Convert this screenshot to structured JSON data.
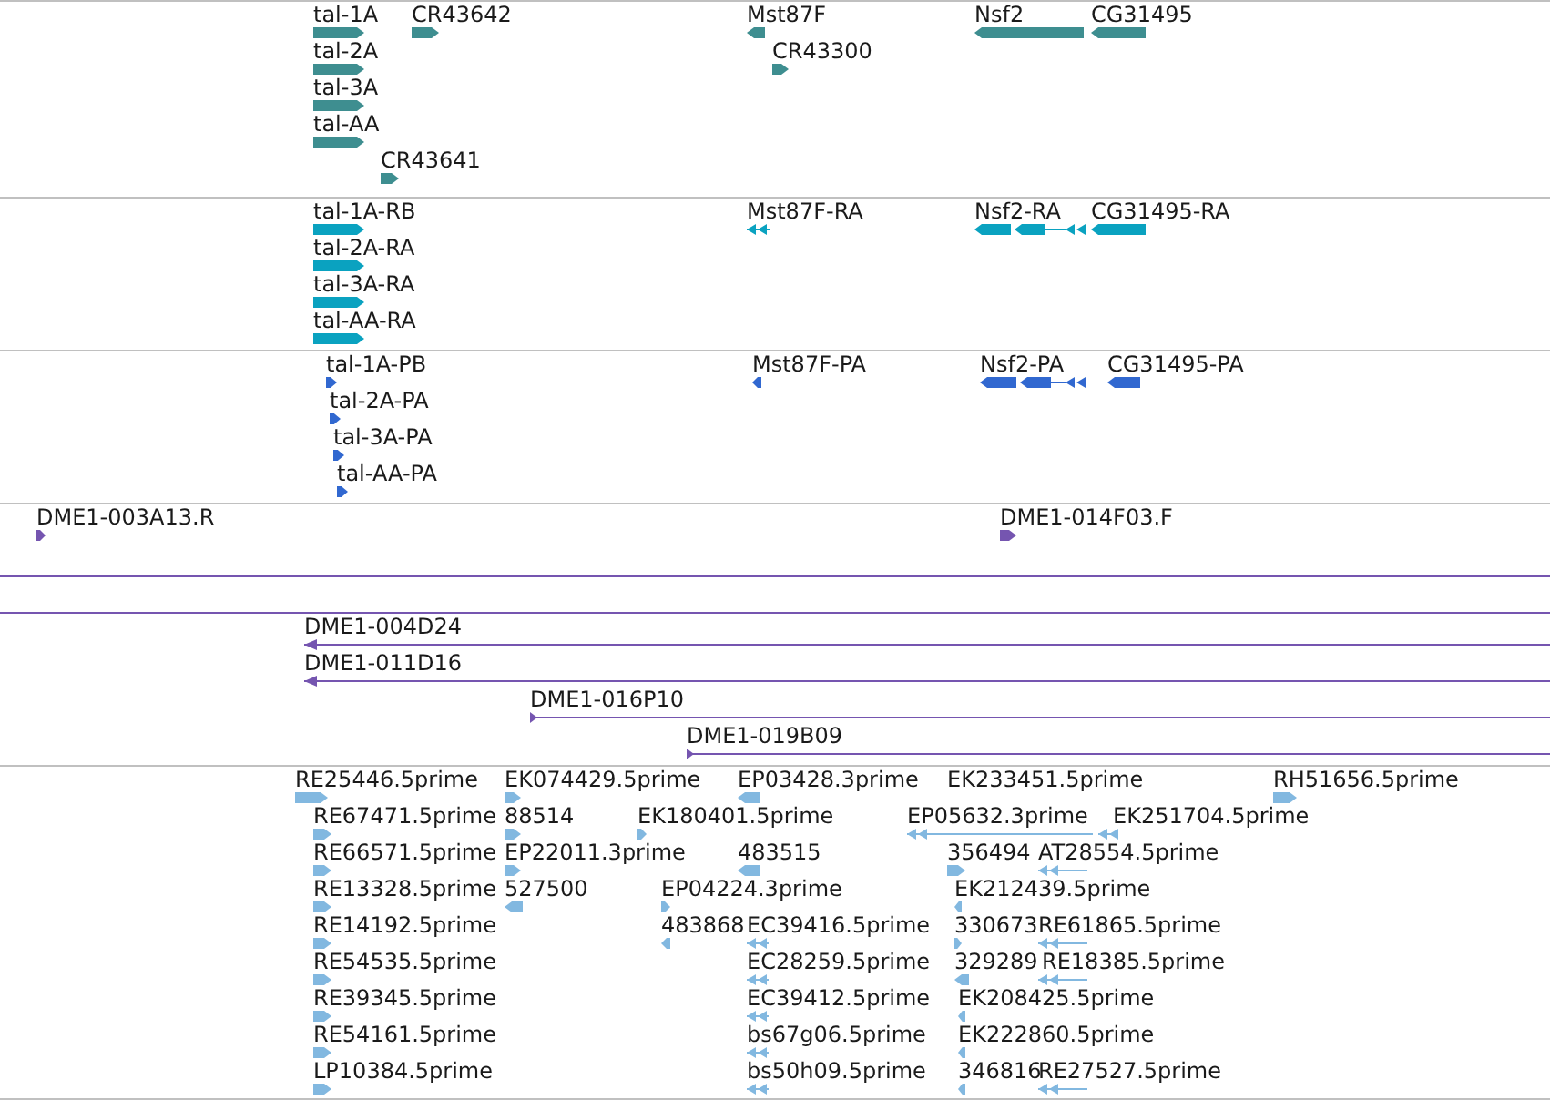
{
  "tracks": [
    {
      "color": "#3e8e90",
      "features": [
        {
          "label": "tal-1A",
          "reverse": false
        },
        {
          "label": "CR43642",
          "reverse": false
        },
        {
          "label": "Mst87F",
          "reverse": true
        },
        {
          "label": "Nsf2",
          "reverse": true
        },
        {
          "label": "CG31495",
          "reverse": true
        },
        {
          "label": "CR43300",
          "reverse": false
        },
        {
          "label": "tal-2A",
          "reverse": false
        },
        {
          "label": "tal-3A",
          "reverse": false
        },
        {
          "label": "tal-AA",
          "reverse": false
        },
        {
          "label": "CR43641",
          "reverse": false
        }
      ]
    },
    {
      "color": "#0aa2c0",
      "features": [
        {
          "label": "tal-1A-RB",
          "reverse": false
        },
        {
          "label": "Mst87F-RA",
          "reverse": true
        },
        {
          "label": "Nsf2-RA",
          "reverse": true
        },
        {
          "label": "CG31495-RA",
          "reverse": true
        },
        {
          "label": "tal-2A-RA",
          "reverse": false
        },
        {
          "label": "tal-3A-RA",
          "reverse": false
        },
        {
          "label": "tal-AA-RA",
          "reverse": false
        }
      ]
    },
    {
      "color": "#3168d0",
      "features": [
        {
          "label": "tal-1A-PB",
          "reverse": false
        },
        {
          "label": "Mst87F-PA",
          "reverse": true
        },
        {
          "label": "Nsf2-PA",
          "reverse": true
        },
        {
          "label": "CG31495-PA",
          "reverse": true
        },
        {
          "label": "tal-2A-PA",
          "reverse": false
        },
        {
          "label": "tal-3A-PA",
          "reverse": false
        },
        {
          "label": "tal-AA-PA",
          "reverse": false
        }
      ]
    },
    {
      "color": "#7555b0",
      "features": [
        {
          "label": "DME1-003A13.R",
          "reverse": false
        },
        {
          "label": "DME1-014F03.F",
          "reverse": false
        }
      ]
    },
    {
      "color": "#7555b0"
    },
    {
      "color": "#7555b0",
      "features": [
        {
          "label": "DME1-004D24",
          "reverse": true
        },
        {
          "label": "DME1-011D16",
          "reverse": true
        },
        {
          "label": "DME1-016P10",
          "reverse": false
        },
        {
          "label": "DME1-019B09",
          "reverse": false
        }
      ]
    },
    {
      "color": "#82b8e0",
      "features": [
        {
          "label": "RE25446.5prime",
          "reverse": false
        },
        {
          "label": "EK074429.5prime",
          "reverse": false
        },
        {
          "label": "EP03428.3prime",
          "reverse": true
        },
        {
          "label": "EK233451.5prime"
        },
        {
          "label": "RH51656.5prime",
          "reverse": false
        },
        {
          "label": "RE67471.5prime",
          "reverse": false
        },
        {
          "label": "88514",
          "reverse": false
        },
        {
          "label": "EK180401.5prime",
          "reverse": false
        },
        {
          "label": "EP05632.3prime",
          "reverse": true
        },
        {
          "label": "EK251704.5prime",
          "reverse": true
        },
        {
          "label": "RE66571.5prime",
          "reverse": false
        },
        {
          "label": "EP22011.3prime",
          "reverse": false
        },
        {
          "label": "483515",
          "reverse": true
        },
        {
          "label": "356494",
          "reverse": false
        },
        {
          "label": "AT28554.5prime",
          "reverse": true
        },
        {
          "label": "RE13328.5prime",
          "reverse": false
        },
        {
          "label": "527500",
          "reverse": true
        },
        {
          "label": "EP04224.3prime",
          "reverse": false
        },
        {
          "label": "EK212439.5prime",
          "reverse": true
        },
        {
          "label": "RE14192.5prime",
          "reverse": false
        },
        {
          "label": "483868",
          "reverse": true
        },
        {
          "label": "EC39416.5prime",
          "reverse": true
        },
        {
          "label": "330673",
          "reverse": false
        },
        {
          "label": "RE61865.5prime",
          "reverse": true
        },
        {
          "label": "RE54535.5prime",
          "reverse": false
        },
        {
          "label": "EC28259.5prime",
          "reverse": true
        },
        {
          "label": "329289",
          "reverse": true
        },
        {
          "label": "RE18385.5prime",
          "reverse": true
        },
        {
          "label": "RE39345.5prime",
          "reverse": false
        },
        {
          "label": "EC39412.5prime",
          "reverse": true
        },
        {
          "label": "EK208425.5prime",
          "reverse": true
        },
        {
          "label": "RE54161.5prime",
          "reverse": false
        },
        {
          "label": "bs67g06.5prime",
          "reverse": true
        },
        {
          "label": "EK222860.5prime",
          "reverse": true
        },
        {
          "label": "LP10384.5prime",
          "reverse": false
        },
        {
          "label": "bs50h09.5prime",
          "reverse": true
        },
        {
          "label": "346816",
          "reverse": true
        },
        {
          "label": "RE27527.5prime",
          "reverse": true
        }
      ]
    }
  ]
}
